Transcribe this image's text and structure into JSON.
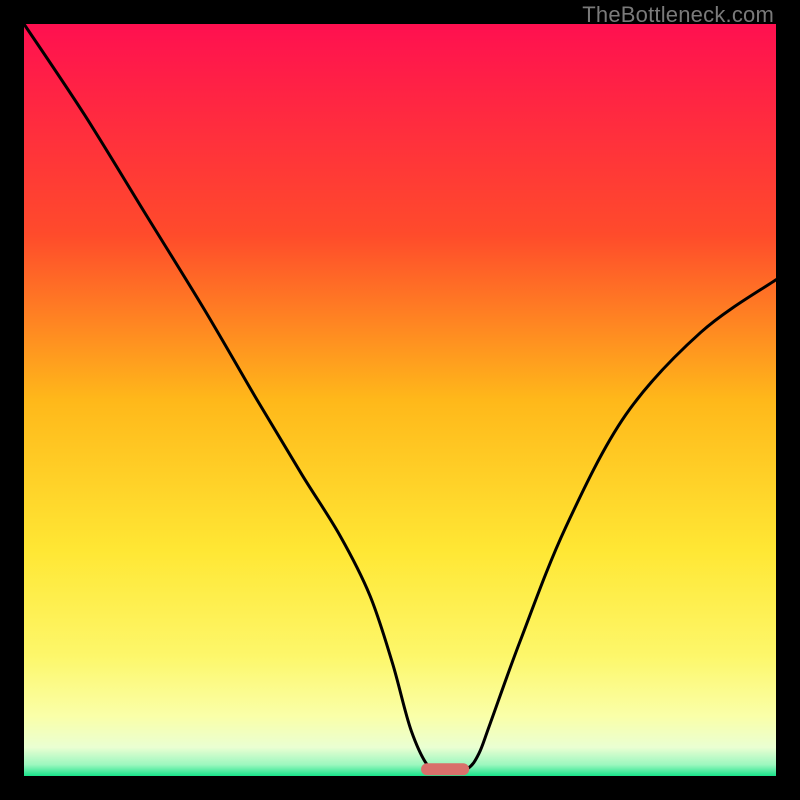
{
  "watermark": "TheBottleneck.com",
  "chart_data": {
    "type": "line",
    "title": "",
    "xlabel": "",
    "ylabel": "",
    "xlim": [
      0,
      100
    ],
    "ylim": [
      0,
      100
    ],
    "grid": false,
    "legend": false,
    "gradient_stops": [
      {
        "offset": 0.0,
        "color": "#ff1050"
      },
      {
        "offset": 0.28,
        "color": "#ff4b2b"
      },
      {
        "offset": 0.5,
        "color": "#ffb81a"
      },
      {
        "offset": 0.7,
        "color": "#ffe734"
      },
      {
        "offset": 0.84,
        "color": "#fdf76a"
      },
      {
        "offset": 0.92,
        "color": "#faffa8"
      },
      {
        "offset": 0.962,
        "color": "#eaffd2"
      },
      {
        "offset": 0.985,
        "color": "#9cf7bf"
      },
      {
        "offset": 1.0,
        "color": "#18e28a"
      }
    ],
    "series": [
      {
        "name": "bottleneck-curve",
        "x": [
          0,
          8,
          16,
          24,
          31,
          37,
          42,
          46,
          49,
          51.5,
          54,
          56.5,
          59,
          60.5,
          62,
          66,
          72,
          80,
          90,
          100
        ],
        "values": [
          100,
          88,
          75,
          62,
          50,
          40,
          32,
          24,
          15,
          6,
          1,
          0.5,
          1,
          3,
          7,
          18,
          33,
          48,
          59,
          66
        ]
      }
    ],
    "marker": {
      "name": "optimal-range-marker",
      "color": "#d9706b",
      "x_center": 56,
      "x_half_width": 3.2,
      "y": 0.9,
      "height": 1.6
    }
  }
}
